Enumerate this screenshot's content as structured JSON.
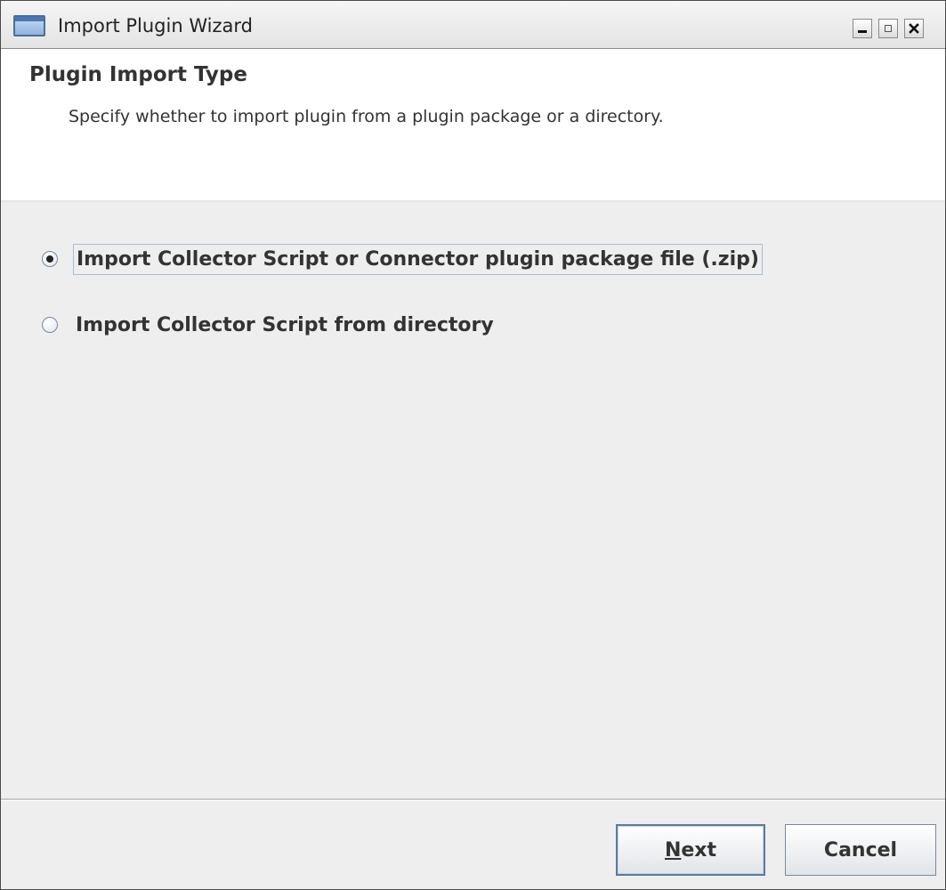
{
  "window": {
    "title": "Import Plugin Wizard"
  },
  "header": {
    "title": "Plugin Import Type",
    "description": "Specify whether to import plugin from a plugin package or a directory."
  },
  "options": [
    {
      "label": "Import Collector Script or Connector plugin package file (.zip)",
      "selected": true
    },
    {
      "label": "Import Collector Script from directory",
      "selected": false
    }
  ],
  "buttons": {
    "next_mnemonic": "N",
    "next_rest": "ext",
    "cancel": "Cancel"
  },
  "icons": {
    "app": "window-icon",
    "minimize": "minimize-icon",
    "maximize": "maximize-icon",
    "close": "close-icon"
  }
}
